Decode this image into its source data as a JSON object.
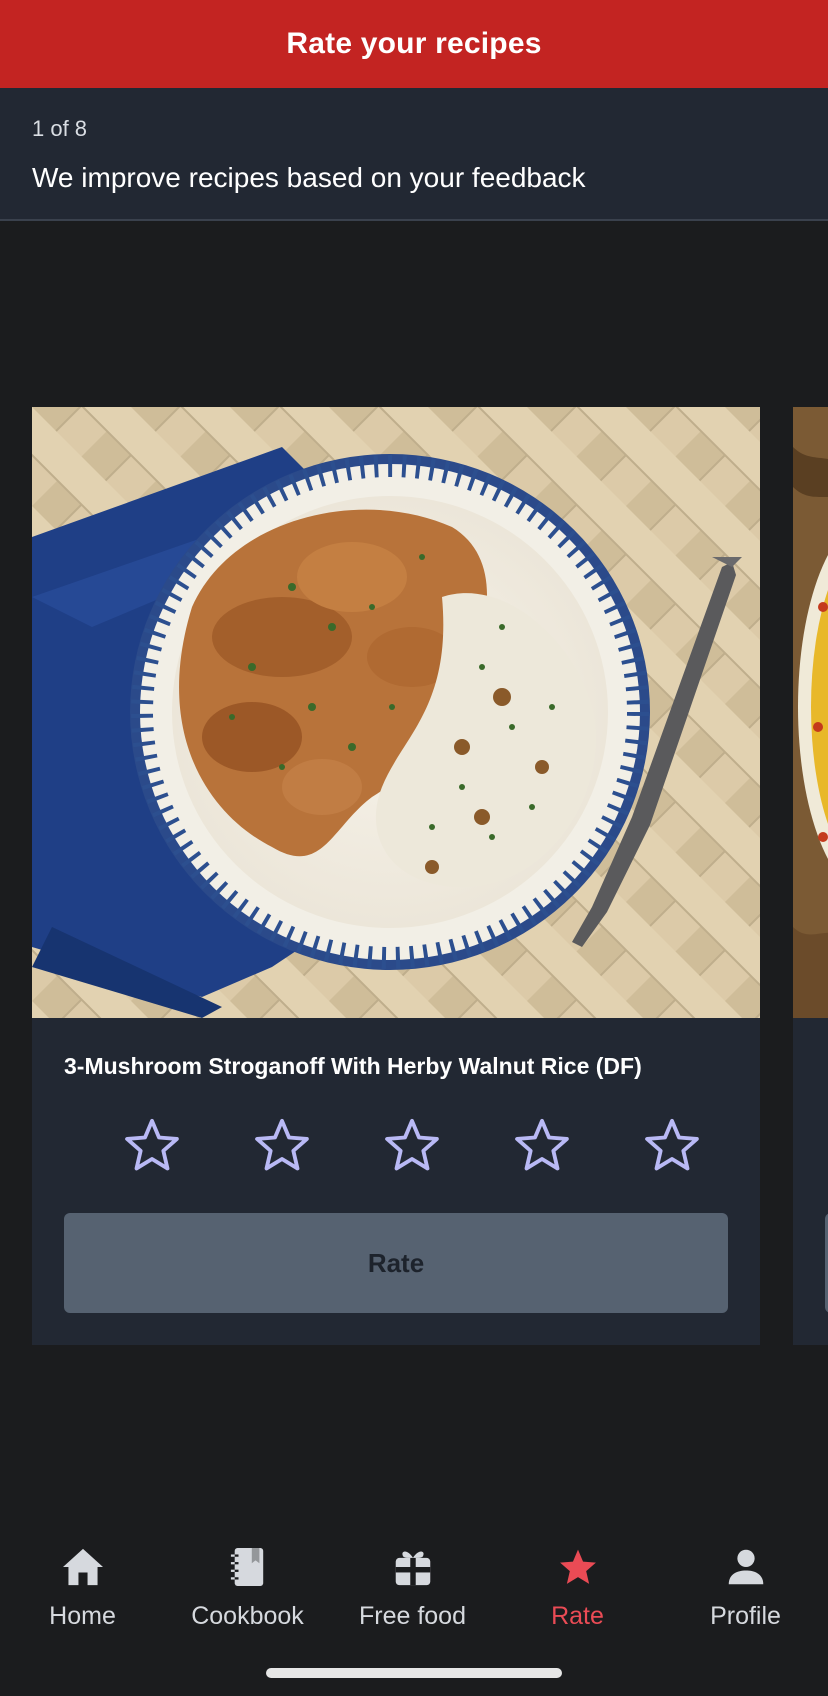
{
  "header": {
    "title": "Rate your recipes"
  },
  "progress": {
    "counter": "1 of 8",
    "tagline": "We improve recipes based on your feedback"
  },
  "recipe": {
    "title": "3-Mushroom Stroganoff With Herby Walnut Rice (DF)",
    "rating_max": 5,
    "rating_selected": 0,
    "rate_label": "Rate",
    "image_alt": "Plate of mushroom stroganoff with herby rice and a fork"
  },
  "nav": {
    "items": [
      {
        "label": "Home",
        "icon": "home-icon"
      },
      {
        "label": "Cookbook",
        "icon": "cookbook-icon"
      },
      {
        "label": "Free food",
        "icon": "gift-icon"
      },
      {
        "label": "Rate",
        "icon": "star-icon",
        "active": true
      },
      {
        "label": "Profile",
        "icon": "person-icon"
      }
    ]
  },
  "colors": {
    "brand_red": "#c32422",
    "active_nav": "#ea4b55",
    "star_outline": "#b9b9f5",
    "card_bg": "#222833",
    "button_disabled": "#566271"
  }
}
